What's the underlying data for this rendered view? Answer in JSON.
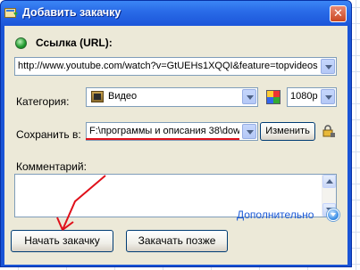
{
  "window": {
    "title": "Добавить закачку",
    "close_glyph": "✕"
  },
  "url": {
    "label": "Ссылка (URL):",
    "value": "http://www.youtube.com/watch?v=GtUEHs1XQQI&feature=topvideos"
  },
  "category": {
    "label": "Категория:",
    "value": "Видео",
    "quality": "1080p"
  },
  "save": {
    "label": "Сохранить в:",
    "path": "F:\\программы и описания 38\\dow",
    "change_button": "Изменить"
  },
  "comment": {
    "label": "Комментарий:",
    "value": ""
  },
  "buttons": {
    "start": "Начать закачку",
    "later": "Закачать позже",
    "more": "Дополнительно"
  },
  "colors": {
    "titlebar": "#2a6ce8",
    "annotation_red": "#e0101a",
    "link_blue": "#1d5bd6"
  },
  "icons": {
    "title": "download-window-icon",
    "url": "green-globe-icon",
    "category": "film-folder-icon",
    "palette": "color-palette-icon",
    "lock": "lock-icon",
    "more": "chevron-circle-down-icon"
  }
}
